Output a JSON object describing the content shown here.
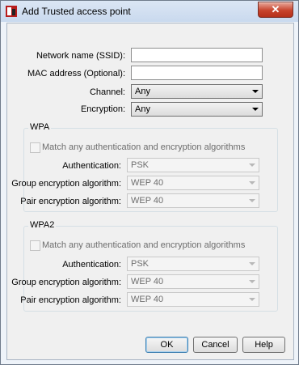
{
  "window": {
    "title": "Add Trusted access point",
    "close_glyph": "✕"
  },
  "form": {
    "ssid_label": "Network name (SSID):",
    "ssid_value": "",
    "mac_label": "MAC address (Optional):",
    "mac_value": "",
    "channel_label": "Channel:",
    "channel_value": "Any",
    "encryption_label": "Encryption:",
    "encryption_value": "Any"
  },
  "wpa": {
    "title": "WPA",
    "match_label": "Match any authentication and encryption algorithms",
    "auth_label": "Authentication:",
    "auth_value": "PSK",
    "group_label": "Group encryption algorithm:",
    "group_value": "WEP 40",
    "pair_label": "Pair encryption algorithm:",
    "pair_value": "WEP 40"
  },
  "wpa2": {
    "title": "WPA2",
    "match_label": "Match any authentication and encryption algorithms",
    "auth_label": "Authentication:",
    "auth_value": "PSK",
    "group_label": "Group encryption algorithm:",
    "group_value": "WEP 40",
    "pair_label": "Pair encryption algorithm:",
    "pair_value": "WEP 40"
  },
  "buttons": {
    "ok": "OK",
    "cancel": "Cancel",
    "help": "Help"
  },
  "icons": {
    "app": "watchguard-logo-icon"
  },
  "colors": {
    "title_bar": "#dbe6f4",
    "close_button": "#c7432c"
  }
}
